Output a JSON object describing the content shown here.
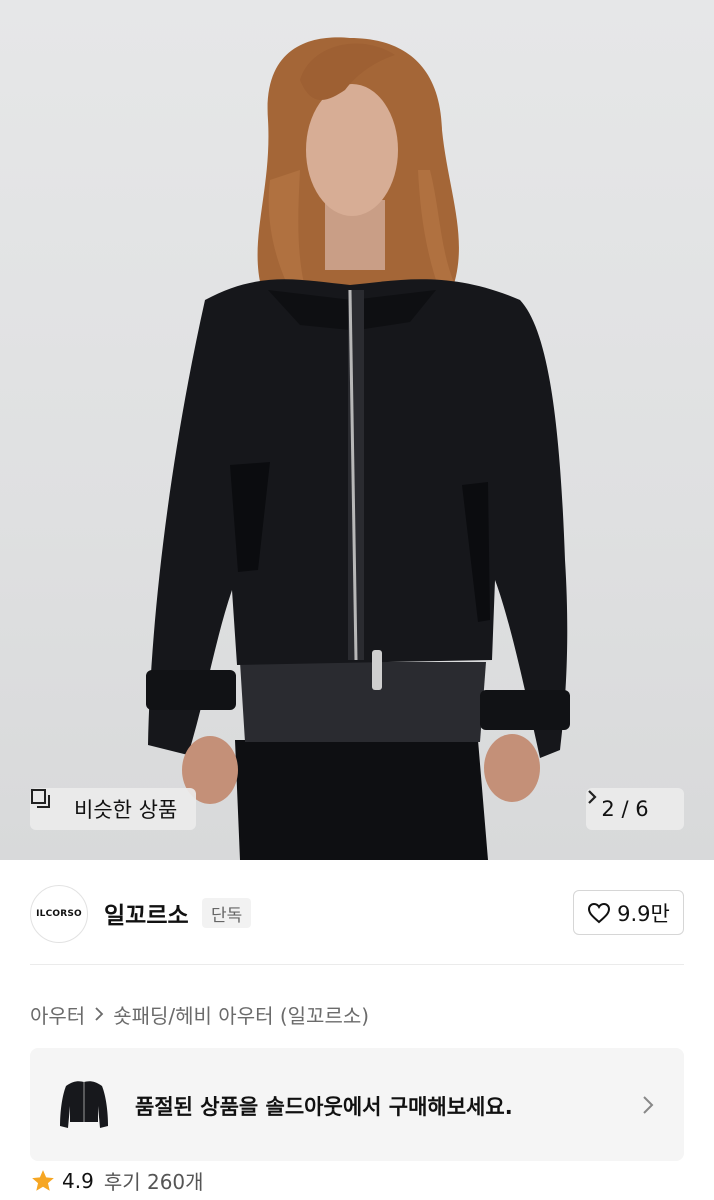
{
  "hero": {
    "similar_label": "비슷한 상품",
    "page_indicator": "2 / 6"
  },
  "brand": {
    "logo_text": "ILCORSO",
    "name": "일꼬르소",
    "badge": "단독",
    "like_count": "9.9만"
  },
  "breadcrumb": {
    "level1": "아우터",
    "level2": "숏패딩/헤비 아우터 (일꼬르소)"
  },
  "banner": {
    "text": "품절된 상품을 솔드아웃에서 구매해보세요."
  },
  "rating": {
    "score": "4.9",
    "reviews": "후기 260개"
  },
  "colors": {
    "star": "#f6a623",
    "jacket": "#16171b",
    "hair": "#a86a3a"
  }
}
